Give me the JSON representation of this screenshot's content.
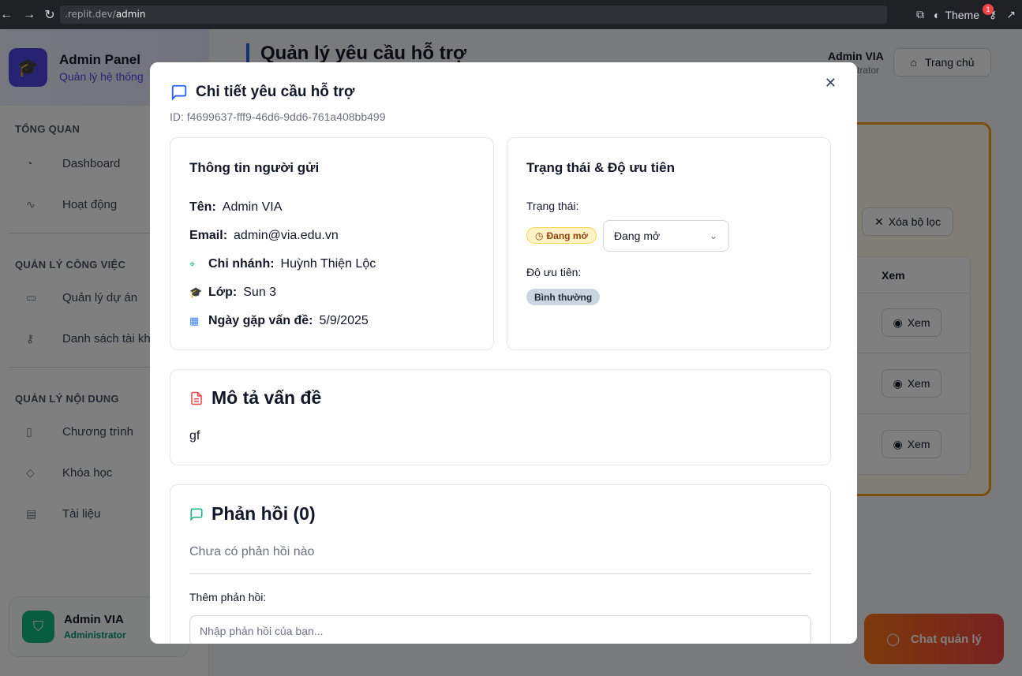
{
  "browser": {
    "url_prefix": ".replit.dev/",
    "url_path": "admin",
    "theme_label": "Theme",
    "notification_count": "1"
  },
  "sidebar": {
    "app_title": "Admin Panel",
    "app_subtitle": "Quản lý hệ thống",
    "sections": [
      {
        "label": "TỔNG QUAN",
        "items": [
          {
            "label": "Dashboard",
            "icon": "gauge-icon"
          },
          {
            "label": "Hoạt động",
            "icon": "activity-icon"
          }
        ]
      },
      {
        "label": "QUẢN LÝ CÔNG VIỆC",
        "items": [
          {
            "label": "Quản lý dự án",
            "icon": "folder-icon"
          },
          {
            "label": "Danh sách tài kh",
            "icon": "key-icon"
          }
        ]
      },
      {
        "label": "QUẢN LÝ NỘI DUNG",
        "items": [
          {
            "label": "Chương trình",
            "icon": "book-icon"
          },
          {
            "label": "Khóa học",
            "icon": "tag-icon"
          },
          {
            "label": "Tài liệu",
            "icon": "file-icon"
          }
        ]
      }
    ],
    "user": {
      "name": "Admin VIA",
      "role": "Administrator"
    }
  },
  "main": {
    "title": "Quản lý yêu cầu hỗ trợ",
    "admin_name": "Admin VIA",
    "admin_role": "strator",
    "home_button": "Trang chủ",
    "clear_filter_button": "Xóa bộ lọc",
    "table_header": "Xem",
    "view_buttons": [
      "Xem",
      "Xem",
      "Xem"
    ],
    "chat_button": "Chat quản lý"
  },
  "modal": {
    "title": "Chi tiết yêu cầu hỗ trợ",
    "id_text": "ID: f4699637-fff9-46d6-9dd6-761a408bb499",
    "sender": {
      "heading": "Thông tin người gửi",
      "name_label": "Tên:",
      "name_value": "Admin VIA",
      "email_label": "Email:",
      "email_value": "admin@via.edu.vn",
      "branch_label": "Chi nhánh:",
      "branch_value": "Huỳnh Thiện Lộc",
      "class_label": "Lớp:",
      "class_value": "Sun 3",
      "date_label": "Ngày gặp vấn đề:",
      "date_value": "5/9/2025"
    },
    "status": {
      "heading": "Trạng thái & Độ ưu tiên",
      "status_label": "Trạng thái:",
      "status_badge": "Đang mở",
      "status_select": "Đang mở",
      "priority_label": "Độ ưu tiên:",
      "priority_badge": "Bình thường"
    },
    "description": {
      "heading": "Mô tả vấn đề",
      "text": "gf"
    },
    "replies": {
      "heading": "Phản hồi (0)",
      "empty_text": "Chưa có phản hồi nào",
      "add_label": "Thêm phản hồi:",
      "input_placeholder": "Nhập phản hồi của bạn..."
    }
  },
  "colors": {
    "accent": "#2563eb",
    "brand": "#4f46e5",
    "success": "#10b981",
    "warning": "#f59e0b",
    "danger": "#ef4444"
  }
}
